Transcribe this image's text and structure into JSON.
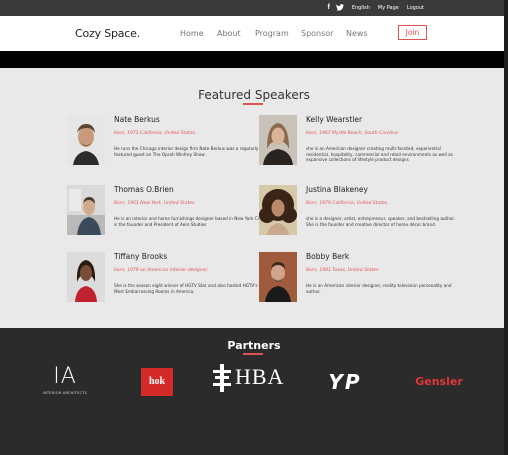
{
  "topbar": {
    "social": {
      "facebook": "f",
      "twitter": "t"
    },
    "links": [
      "English",
      "My Page",
      "Logout"
    ]
  },
  "nav": {
    "brand": "Cozy Space.",
    "items": [
      "Home",
      "About",
      "Program",
      "Sponsor",
      "News"
    ],
    "join": "Join"
  },
  "speakers": {
    "title": "Featured Speakers",
    "list": [
      {
        "name": "Nate Berkus",
        "born": "born, 1971 California, United States.",
        "bio": "He runs the Chicago interior design firm Nate Berkus was a regularly featured guest on The Oprah Winfrey Show."
      },
      {
        "name": "Kelly Wearstler",
        "born": "born, 1967 Myrtle Beach, South Carolina.",
        "bio": "she is an American designer creating multi-faceted, experiential residential, hospitality, commercial and retail environments as well as expansive collections of lifestyle product designs"
      },
      {
        "name": "Thomas O.Brien",
        "born": "Born, 1961 New York, United States.",
        "bio": "He is an interior and home furnishings designer based in New York City. He is the founder and President of Aero Studios"
      },
      {
        "name": "Justina Blakeney",
        "born": "Born, 1979 California, United States.",
        "bio": "she is a designer, artist, entrepreneur, speaker, and bestselling author. She is the founder and creative director of home décor brand."
      },
      {
        "name": "Tiffany Brooks",
        "born": "born, 1979 an American interior designer.",
        "bio": "She is the season eight winner of HGTV Star and also hosted HGTV's The Most Embarrassing Rooms in America."
      },
      {
        "name": "Bobby Berk",
        "born": "Born, 1981 Texas, United States",
        "bio": "He is an American interior designer, reality television personality and author."
      }
    ]
  },
  "partners": {
    "title": "Partners",
    "logos": [
      {
        "name": "IA",
        "sub": "INTERIOR ARCHITECTS"
      },
      {
        "name": "hok"
      },
      {
        "name": "HBA"
      },
      {
        "name": "YP"
      },
      {
        "name": "Gensler"
      }
    ]
  },
  "colors": {
    "accent": "#e05252",
    "dark": "#2b2b2b",
    "light": "#e9e9e9"
  }
}
